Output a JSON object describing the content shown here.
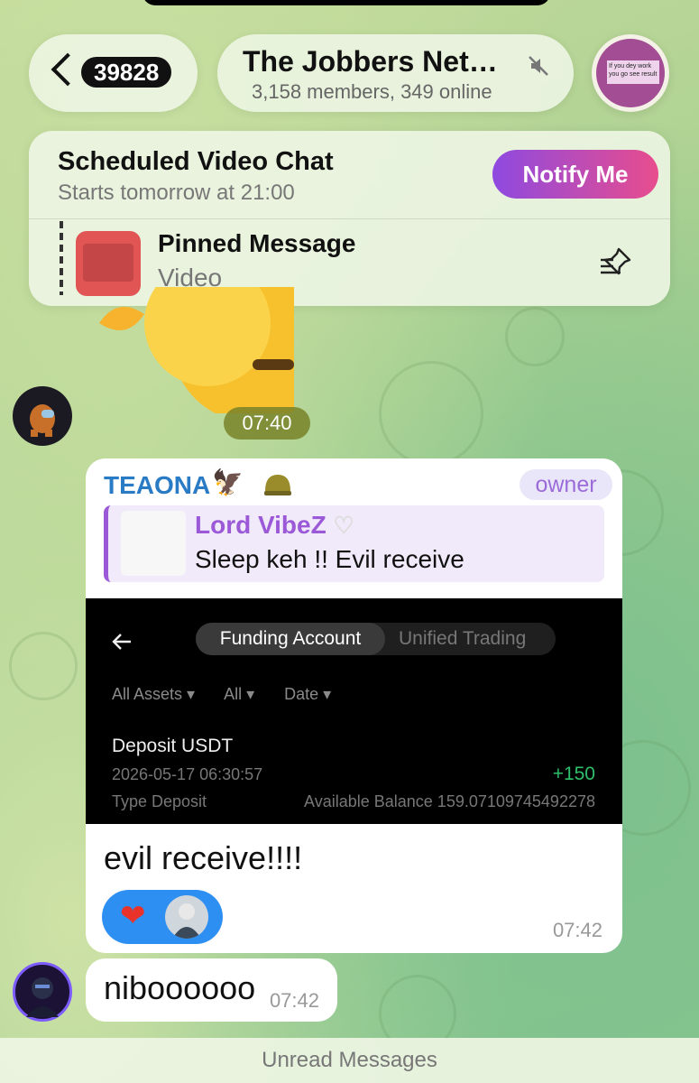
{
  "header": {
    "back_count": "39828",
    "chat_title": "The Jobbers Net…",
    "chat_subtitle": "3,158 members, 349 online",
    "avatar_text": "If you dey work you go see result"
  },
  "video_chat": {
    "title": "Scheduled Video Chat",
    "subtitle": "Starts tomorrow at 21:00",
    "notify_label": "Notify Me"
  },
  "pinned": {
    "title": "Pinned Message",
    "subtitle": "Video"
  },
  "sticker_time": "07:40",
  "message1": {
    "sender": "TEAONA",
    "badge": "owner",
    "reply_author": "Lord VibeZ",
    "reply_text": "Sleep keh !! Evil receive",
    "screenshot": {
      "tab_active": "Funding Account",
      "tab_inactive": "Unified Trading",
      "filters": [
        "All Assets ▾",
        "All ▾",
        "Date ▾"
      ],
      "deposit_title": "Deposit USDT",
      "deposit_time": "2026-05-17 06:30:57",
      "deposit_amount": "+150",
      "deposit_type": "Type Deposit",
      "deposit_balance": "Available Balance 159.07109745492278"
    },
    "text": "evil receive!!!!",
    "time": "07:42"
  },
  "message2": {
    "text": "niboooooo",
    "time": "07:42"
  },
  "unread_label": "Unread Messages",
  "colors": {
    "accent_blue": "#2a7bc5",
    "owner_purple": "#9b6bd9",
    "deposit_green": "#2fbe6a",
    "notify_gradient_start": "#8e4ae0",
    "notify_gradient_end": "#e84d8d"
  },
  "icons": {
    "back": "chevron-left-icon",
    "mute": "mute-icon",
    "unpin": "unpin-icon",
    "screenshot_back": "arrow-left-icon"
  }
}
